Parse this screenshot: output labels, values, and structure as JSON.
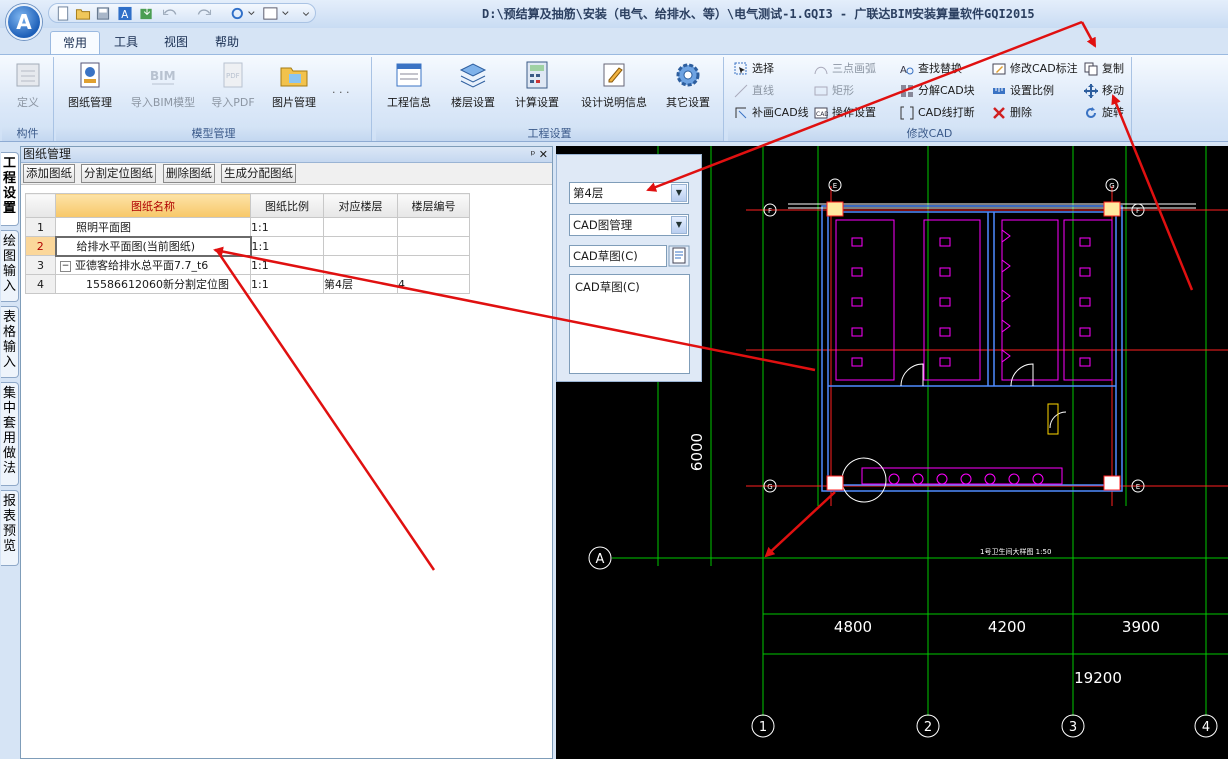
{
  "app": {
    "orb_letter": "A",
    "title": "D:\\预结算及抽筋\\安装（电气、给排水、等）\\电气测试-1.GQI3 - 广联达BIM安装算量软件GQI2015"
  },
  "ribbon": {
    "tabs": [
      "常用",
      "工具",
      "视图",
      "帮助"
    ],
    "groups": {
      "component": {
        "label": "构件",
        "define": "定义"
      },
      "model": {
        "label": "模型管理",
        "drawing_mgmt": "图纸管理",
        "import_bim": "导入BIM模型",
        "import_pdf": "导入PDF",
        "image_mgmt": "图片管理",
        "more": "· · ·"
      },
      "project": {
        "label": "工程设置",
        "project_info": "工程信息",
        "floor_settings": "楼层设置",
        "calc_settings": "计算设置",
        "design_notes": "设计说明信息",
        "other_settings": "其它设置"
      },
      "cad": {
        "label": "修改CAD",
        "select": "选择",
        "three_point_arc": "三点画弧",
        "find_replace": "查找替换",
        "modify_cad_label": "修改CAD标注",
        "copy": "复制",
        "line": "直线",
        "rectangle": "矩形",
        "explode_cad": "分解CAD块",
        "set_scale": "设置比例",
        "move": "移动",
        "supplement_cad_line": "补画CAD线",
        "operation_settings": "操作设置",
        "cad_line_break": "CAD线打断",
        "delete": "删除",
        "rotate": "旋转"
      }
    }
  },
  "left_tabs": [
    "工程设置",
    "绘图输入",
    "表格输入",
    "集中套用做法",
    "报表预览"
  ],
  "drawing_manager": {
    "title": "图纸管理",
    "header_icons": "ᵖ ✕",
    "toolbar": [
      "添加图纸",
      "分割定位图纸",
      "删除图纸",
      "生成分配图纸"
    ],
    "columns": [
      "图纸名称",
      "图纸比例",
      "对应楼层",
      "楼层编号"
    ],
    "rows": [
      {
        "num": "1",
        "name": "照明平面图",
        "scale": "1:1",
        "floor": "",
        "floor_no": ""
      },
      {
        "num": "2",
        "name": "给排水平面图(当前图纸)",
        "scale": "1:1",
        "floor": "",
        "floor_no": ""
      },
      {
        "num": "3",
        "name": "亚德客给排水总平面7.7_t6",
        "scale": "1:1",
        "floor": "",
        "floor_no": "",
        "expander": "−"
      },
      {
        "num": "4",
        "name": "15586612060新分割定位图",
        "scale": "1:1",
        "floor": "第4层",
        "floor_no": "4"
      }
    ]
  },
  "cad_panel": {
    "floor_select": "第4层",
    "mode_select": "CAD图管理",
    "sketch_select": "CAD草图(C)",
    "sketch_list_item": "CAD草图(C)"
  },
  "cad_drawing": {
    "dim_vertical": "6000",
    "dims_bottom": [
      "4800",
      "4200",
      "3900"
    ],
    "dim_total": "19200",
    "axis_bottom": [
      "1",
      "2",
      "3",
      "4"
    ],
    "axis_left": "A",
    "small_labels": [
      "E",
      "G",
      "F",
      "F",
      "G",
      "E"
    ],
    "caption": "1号卫生间大样图   1:50",
    "colors": {
      "grid": "#00c800",
      "wall": "#ffffff",
      "fixtures": "#ff00ff",
      "pipes": "#ff0000",
      "dim": "#ffffff",
      "walls_blue": "#4f8cff"
    }
  },
  "annotation_color": "#e01010"
}
